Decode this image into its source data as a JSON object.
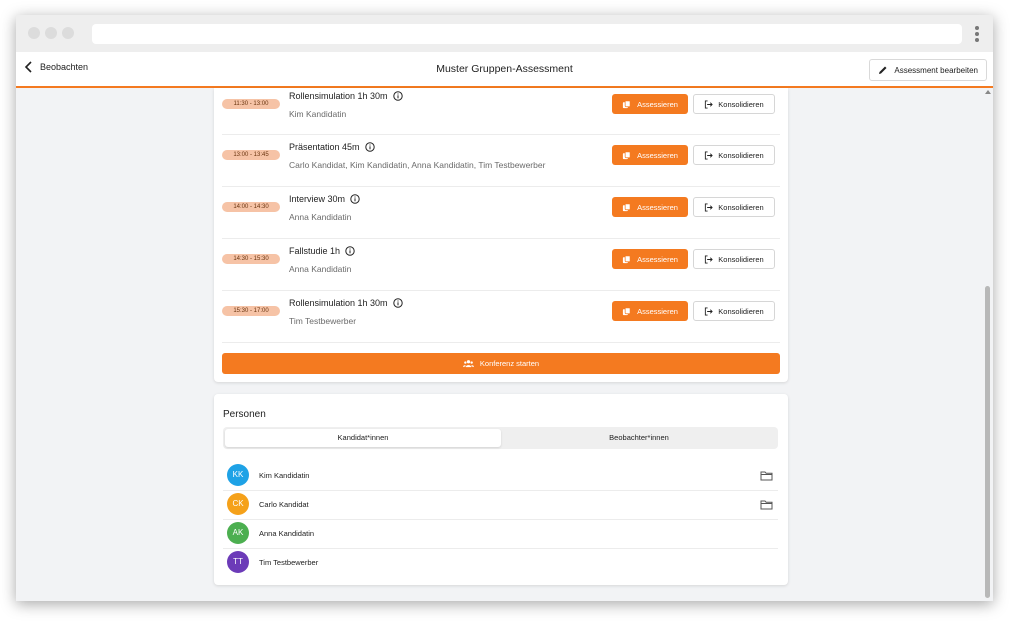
{
  "header": {
    "back_label": "Beobachten",
    "title": "Muster Gruppen-Assessment",
    "edit_label": "Assessment bearbeiten"
  },
  "schedule": [
    {
      "time": "11:30 - 13:00",
      "title": "Rollensimulation 1h 30m",
      "people": "Kim Kandidatin"
    },
    {
      "time": "13:00 - 13:45",
      "title": "Präsentation 45m",
      "people": "Carlo Kandidat, Kim Kandidatin, Anna Kandidatin, Tim Testbewerber"
    },
    {
      "time": "14:00 - 14:30",
      "title": "Interview 30m",
      "people": "Anna Kandidatin"
    },
    {
      "time": "14:30 - 15:30",
      "title": "Fallstudie 1h",
      "people": "Anna Kandidatin"
    },
    {
      "time": "15:30 - 17:00",
      "title": "Rollensimulation 1h 30m",
      "people": "Tim Testbewerber"
    }
  ],
  "actions": {
    "assess_label": "Assessieren",
    "consolidate_label": "Konsolidieren",
    "conference_label": "Konferenz starten"
  },
  "persons": {
    "title": "Personen",
    "tabs": [
      "Kandidat*innen",
      "Beobachter*innen"
    ],
    "active_tab": "Kandidat*innen",
    "list": [
      {
        "initials": "KK",
        "name": "Kim Kandidatin",
        "color": "#1ea2e6",
        "folder": true
      },
      {
        "initials": "CK",
        "name": "Carlo Kandidat",
        "color": "#f5a11a",
        "folder": true
      },
      {
        "initials": "AK",
        "name": "Anna Kandidatin",
        "color": "#4caf50",
        "folder": false
      },
      {
        "initials": "TT",
        "name": "Tim Testbewerber",
        "color": "#6c3bb8",
        "folder": false
      }
    ]
  },
  "colors": {
    "accent": "#f47a20",
    "time_pill": "#f6c3a6"
  },
  "icons": [
    "chevron-left-icon",
    "pencil-icon",
    "info-icon",
    "assess-icon",
    "logout-icon",
    "group-icon",
    "folder-icon"
  ]
}
